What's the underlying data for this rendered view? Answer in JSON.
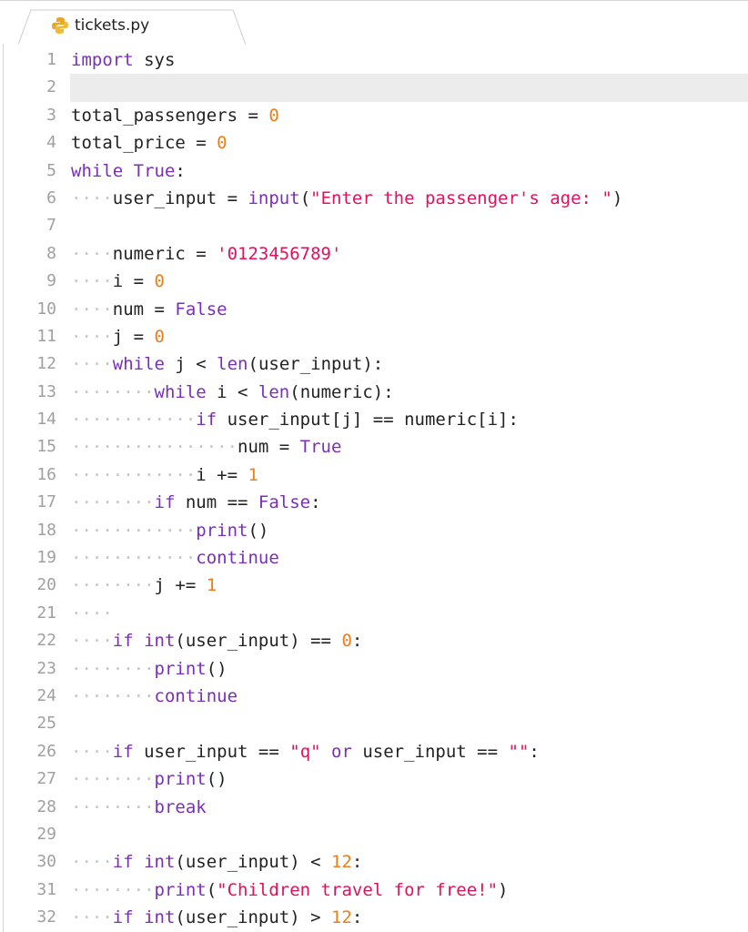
{
  "tab": {
    "filename": "tickets.py",
    "icon": "python-icon"
  },
  "active_line": 2,
  "lines": [
    {
      "n": "1",
      "tokens": [
        [
          "kw",
          "import"
        ],
        [
          "",
          "  sys"
        ]
      ]
    },
    {
      "n": "2",
      "tokens": []
    },
    {
      "n": "3",
      "tokens": [
        [
          "",
          "total_passengers = "
        ],
        [
          "nu",
          "0"
        ]
      ]
    },
    {
      "n": "4",
      "tokens": [
        [
          "",
          "total_price = "
        ],
        [
          "nu",
          "0"
        ]
      ]
    },
    {
      "n": "5",
      "tokens": [
        [
          "kw",
          "while True"
        ],
        [
          "",
          ":"
        ]
      ]
    },
    {
      "n": "6",
      "tokens": [
        [
          "ws",
          "····"
        ],
        [
          "",
          "user_input = "
        ],
        [
          "kw",
          "input"
        ],
        [
          "",
          "("
        ],
        [
          "st",
          "\"Enter the passenger's age: \""
        ],
        [
          "",
          ")"
        ]
      ]
    },
    {
      "n": "7",
      "tokens": []
    },
    {
      "n": "8",
      "tokens": [
        [
          "ws",
          "····"
        ],
        [
          "",
          "numeric = "
        ],
        [
          "st",
          "'0123456789'"
        ]
      ]
    },
    {
      "n": "9",
      "tokens": [
        [
          "ws",
          "····"
        ],
        [
          "",
          "i = "
        ],
        [
          "nu",
          "0"
        ]
      ]
    },
    {
      "n": "10",
      "tokens": [
        [
          "ws",
          "····"
        ],
        [
          "",
          "num = "
        ],
        [
          "kw",
          "False"
        ]
      ]
    },
    {
      "n": "11",
      "tokens": [
        [
          "ws",
          "····"
        ],
        [
          "",
          "j = "
        ],
        [
          "nu",
          "0"
        ]
      ]
    },
    {
      "n": "12",
      "tokens": [
        [
          "ws",
          "····"
        ],
        [
          "kw",
          "while"
        ],
        [
          "",
          " j < "
        ],
        [
          "kw",
          "len"
        ],
        [
          "",
          "(user_input):"
        ]
      ]
    },
    {
      "n": "13",
      "tokens": [
        [
          "ws",
          "········"
        ],
        [
          "kw",
          "while"
        ],
        [
          "",
          " i < "
        ],
        [
          "kw",
          "len"
        ],
        [
          "",
          "(numeric):"
        ]
      ]
    },
    {
      "n": "14",
      "tokens": [
        [
          "ws",
          "············"
        ],
        [
          "kw",
          "if"
        ],
        [
          "",
          " user_input[j] == numeric[i]:"
        ]
      ]
    },
    {
      "n": "15",
      "tokens": [
        [
          "ws",
          "················"
        ],
        [
          "",
          "num = "
        ],
        [
          "kw",
          "True"
        ]
      ]
    },
    {
      "n": "16",
      "tokens": [
        [
          "ws",
          "············"
        ],
        [
          "",
          "i += "
        ],
        [
          "nu",
          "1"
        ]
      ]
    },
    {
      "n": "17",
      "tokens": [
        [
          "ws",
          "········"
        ],
        [
          "kw",
          "if"
        ],
        [
          "",
          " num == "
        ],
        [
          "kw",
          "False"
        ],
        [
          "",
          ":"
        ]
      ]
    },
    {
      "n": "18",
      "tokens": [
        [
          "ws",
          "············"
        ],
        [
          "kw",
          "print"
        ],
        [
          "",
          "()"
        ]
      ]
    },
    {
      "n": "19",
      "tokens": [
        [
          "ws",
          "············"
        ],
        [
          "kw",
          "continue"
        ]
      ]
    },
    {
      "n": "20",
      "tokens": [
        [
          "ws",
          "········"
        ],
        [
          "",
          "j += "
        ],
        [
          "nu",
          "1"
        ]
      ]
    },
    {
      "n": "21",
      "tokens": [
        [
          "ws",
          "····"
        ]
      ]
    },
    {
      "n": "22",
      "tokens": [
        [
          "ws",
          "····"
        ],
        [
          "kw",
          "if int"
        ],
        [
          "",
          "(user_input) == "
        ],
        [
          "nu",
          "0"
        ],
        [
          "",
          ":"
        ]
      ]
    },
    {
      "n": "23",
      "tokens": [
        [
          "ws",
          "········"
        ],
        [
          "kw",
          "print"
        ],
        [
          "",
          "()"
        ]
      ]
    },
    {
      "n": "24",
      "tokens": [
        [
          "ws",
          "········"
        ],
        [
          "kw",
          "continue"
        ]
      ]
    },
    {
      "n": "25",
      "tokens": []
    },
    {
      "n": "26",
      "tokens": [
        [
          "ws",
          "····"
        ],
        [
          "kw",
          "if"
        ],
        [
          "",
          " user_input == "
        ],
        [
          "st",
          "\"q\""
        ],
        [
          "kw",
          " or"
        ],
        [
          "",
          " user_input == "
        ],
        [
          "st",
          "\"\""
        ],
        [
          "",
          ":"
        ]
      ]
    },
    {
      "n": "27",
      "tokens": [
        [
          "ws",
          "········"
        ],
        [
          "kw",
          "print"
        ],
        [
          "",
          "()"
        ]
      ]
    },
    {
      "n": "28",
      "tokens": [
        [
          "ws",
          "········"
        ],
        [
          "kw",
          "break"
        ]
      ]
    },
    {
      "n": "29",
      "tokens": []
    },
    {
      "n": "30",
      "tokens": [
        [
          "ws",
          "····"
        ],
        [
          "kw",
          "if int"
        ],
        [
          "",
          "(user_input) < "
        ],
        [
          "nu",
          "12"
        ],
        [
          "",
          ":"
        ]
      ]
    },
    {
      "n": "31",
      "tokens": [
        [
          "ws",
          "········"
        ],
        [
          "kw",
          "print"
        ],
        [
          "",
          "("
        ],
        [
          "st",
          "\"Children travel for free!\""
        ],
        [
          "",
          ")"
        ]
      ]
    },
    {
      "n": "32",
      "tokens": [
        [
          "ws",
          "····"
        ],
        [
          "kw",
          "if int"
        ],
        [
          "",
          "(user_input) > "
        ],
        [
          "nu",
          "12"
        ],
        [
          "",
          ":"
        ]
      ]
    }
  ]
}
